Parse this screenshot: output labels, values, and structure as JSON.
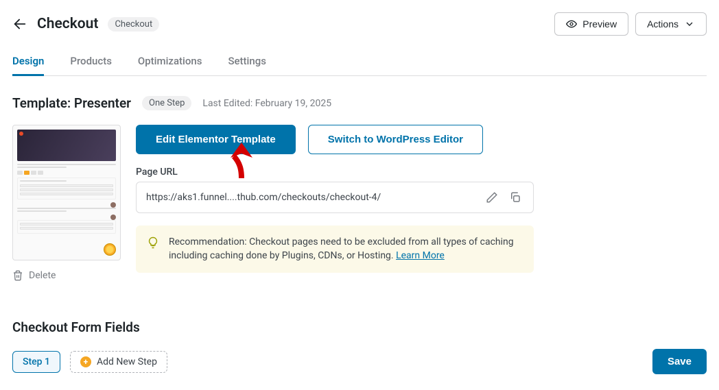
{
  "header": {
    "title": "Checkout",
    "badge": "Checkout",
    "preview_label": "Preview",
    "actions_label": "Actions"
  },
  "tabs": [
    {
      "label": "Design",
      "active": true
    },
    {
      "label": "Products",
      "active": false
    },
    {
      "label": "Optimizations",
      "active": false
    },
    {
      "label": "Settings",
      "active": false
    }
  ],
  "template": {
    "title_prefix": "Template: ",
    "title_name": "Presenter",
    "step_badge": "One Step",
    "last_edited": "Last Edited: February 19, 2025",
    "delete_label": "Delete"
  },
  "buttons": {
    "edit_template": "Edit Elementor Template",
    "switch_editor": "Switch to WordPress Editor"
  },
  "page_url": {
    "label": "Page URL",
    "value": "https://aks1.funnel....thub.com/checkouts/checkout-4/"
  },
  "notice": {
    "text_prefix": "Recommendation: Checkout pages need to be excluded from all types of caching including caching done by Plugins, CDNs, or Hosting. ",
    "link_label": "Learn More"
  },
  "form_fields": {
    "section_title": "Checkout Form Fields",
    "step1_label": "Step 1",
    "add_step_label": "Add New Step",
    "save_label": "Save"
  }
}
